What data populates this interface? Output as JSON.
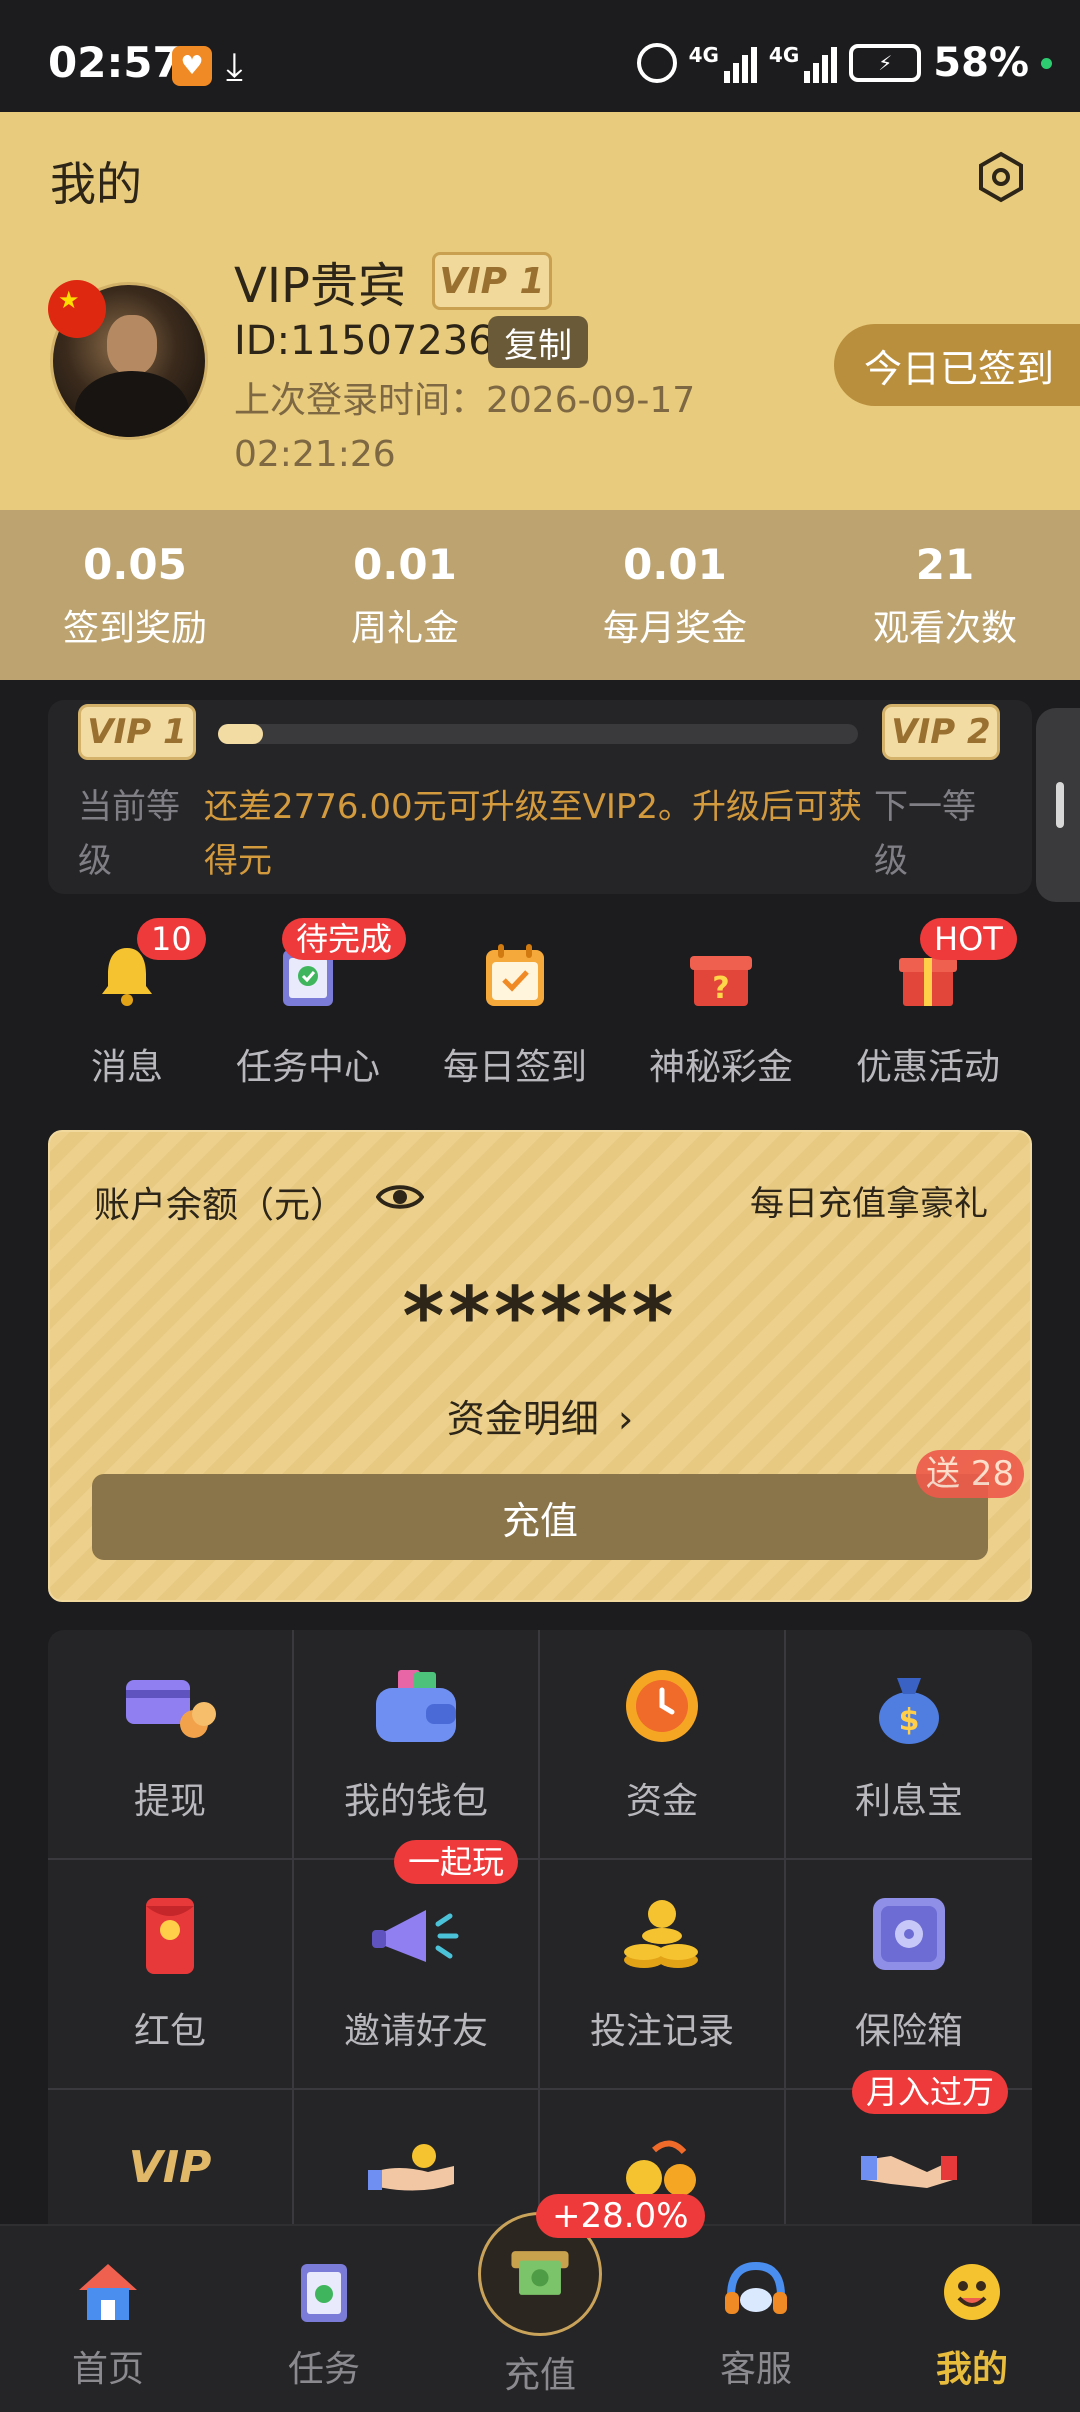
{
  "status_bar": {
    "time": "02:57",
    "battery": "58%",
    "net1": "4G",
    "net2": "4G"
  },
  "header": {
    "title": "我的"
  },
  "user": {
    "name": "VIP贵宾",
    "vip_level": "VIP 1",
    "id": "ID:11507236",
    "copy_label": "复制",
    "last_login": "上次登录时间：2026-09-17 02:21:26",
    "signed_in_label": "今日已签到"
  },
  "stats": [
    {
      "value": "0.05",
      "label": "签到奖励"
    },
    {
      "value": "0.01",
      "label": "周礼金"
    },
    {
      "value": "0.01",
      "label": "每月奖金"
    },
    {
      "value": "21",
      "label": "观看次数"
    }
  ],
  "vip_progress": {
    "current_tag": "VIP 1",
    "next_tag": "VIP 2",
    "progress_fraction": 0.07,
    "current_label": "当前等级",
    "message": "还差2776.00元可升级至VIP2。升级后可获得元",
    "next_label": "下一等级"
  },
  "quick_menu": [
    {
      "label": "消息",
      "icon": "bell-icon",
      "badge": "10"
    },
    {
      "label": "任务中心",
      "icon": "clipboard-check-icon",
      "badge": "待完成"
    },
    {
      "label": "每日签到",
      "icon": "calendar-check-icon",
      "badge": ""
    },
    {
      "label": "神秘彩金",
      "icon": "mystery-box-icon",
      "badge": ""
    },
    {
      "label": "优惠活动",
      "icon": "gift-icon",
      "badge": "HOT"
    }
  ],
  "balance": {
    "label": "账户余额（元）",
    "promo": "每日充值拿豪礼",
    "value": "******",
    "detail_label": "资金明细",
    "recharge_label": "充值",
    "gift_badge": "送 28"
  },
  "grid": [
    {
      "label": "提现",
      "icon": "withdraw-card-icon",
      "badge": ""
    },
    {
      "label": "我的钱包",
      "icon": "wallet-icon",
      "badge": ""
    },
    {
      "label": "资金",
      "icon": "fund-clock-icon",
      "badge": ""
    },
    {
      "label": "利息宝",
      "icon": "money-bag-icon",
      "badge": ""
    },
    {
      "label": "红包",
      "icon": "red-envelope-icon",
      "badge": ""
    },
    {
      "label": "邀请好友",
      "icon": "megaphone-icon",
      "badge": "一起玩"
    },
    {
      "label": "投注记录",
      "icon": "coin-stack-icon",
      "badge": ""
    },
    {
      "label": "保险箱",
      "icon": "safe-icon",
      "badge": ""
    },
    {
      "label": "",
      "icon": "vip-icon",
      "badge": ""
    },
    {
      "label": "",
      "icon": "hand-coin-icon",
      "badge": ""
    },
    {
      "label": "",
      "icon": "coin-exchange-icon",
      "badge": ""
    },
    {
      "label": "",
      "icon": "handshake-icon",
      "badge": "月入过万"
    }
  ],
  "nav": {
    "items": [
      {
        "label": "首页",
        "icon": "home-icon"
      },
      {
        "label": "任务",
        "icon": "task-clipboard-icon"
      },
      {
        "label": "充值",
        "icon": "recharge-icon"
      },
      {
        "label": "客服",
        "icon": "headset-icon"
      },
      {
        "label": "我的",
        "icon": "smiley-icon"
      }
    ],
    "active": "我的",
    "center_badge": "+28.0%"
  },
  "colors": {
    "header_gold": "#e8cb7c",
    "stats_bar": "#bca36f",
    "accent_text": "#d39a3e",
    "badge_red": "#ee3a3a",
    "nav_active": "#e8bc3c"
  }
}
